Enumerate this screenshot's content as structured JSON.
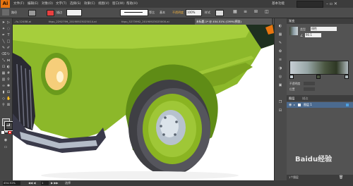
{
  "app": {
    "logo": "Ai"
  },
  "menu": [
    "文件(F)",
    "编辑(E)",
    "对象(O)",
    "文字(T)",
    "选择(S)",
    "效果(C)",
    "视图(V)",
    "窗口(W)",
    "帮助(H)"
  ],
  "workspace": "基本功能",
  "control_bar": {
    "label_path": "路径",
    "stroke_label": "描边",
    "style_label": "等比",
    "basic_label": "基本",
    "opacity_label": "不透明度",
    "opacity_value": "100%",
    "style2_label": "样式"
  },
  "tabs": [
    "..fu.12458.ai",
    "tkpu_2292799_20190923025014.ai",
    "tkpu_5273992_20190923025000.ai",
    "未标题-1* @ 454.51% (CMYK/预览)"
  ],
  "active_tab_index": 3,
  "panels": {
    "gradient_title": "渐变",
    "gradient_type_label": "类型",
    "gradient_type_value": "线性",
    "angle_value": "90.1",
    "opacity_label": "不透明度",
    "position_label": "位置",
    "layers_title": "图层",
    "layers_tab2": "描边",
    "layer_name": "图层 1",
    "layer_count": "1个图层"
  },
  "status": {
    "zoom": "454.51%",
    "page": "1",
    "tool": "选择"
  },
  "watermark": "Baidu经验",
  "colors": {
    "car_body": "#8cb82a",
    "car_body_light": "#a6ce3c",
    "car_body_dark": "#5f8c16",
    "tire": "#3f3f44",
    "rim": "#8ab422",
    "hubcap": "#b7c2ce",
    "headlight": "#f6ce7a",
    "chrome": "#3a3a4a",
    "accent": "#e87510"
  }
}
